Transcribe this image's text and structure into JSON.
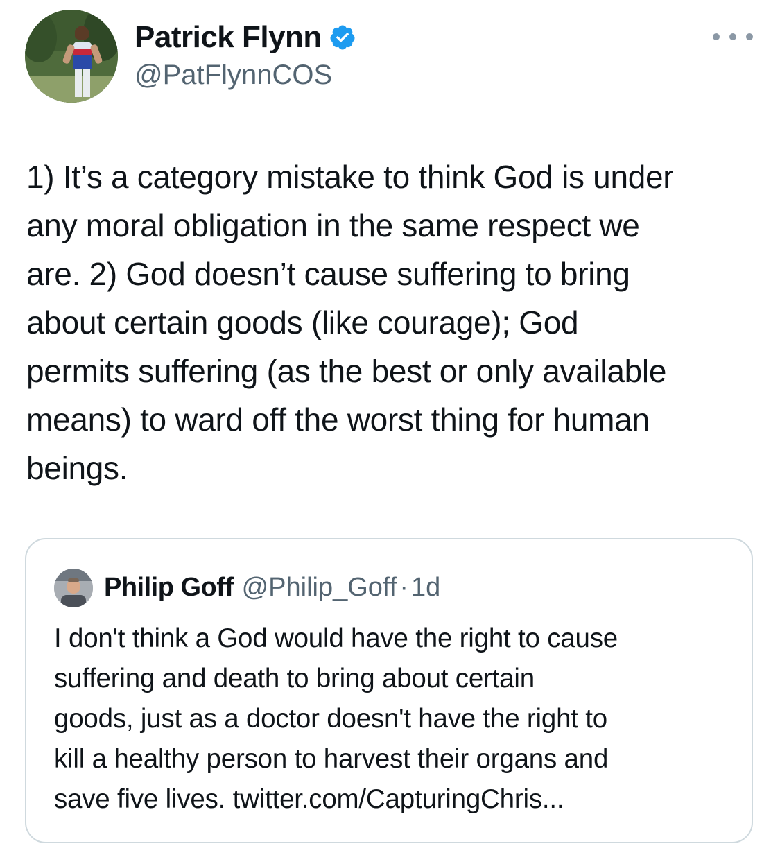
{
  "author": {
    "name": "Patrick Flynn",
    "handle": "@PatFlynnCOS",
    "verified_color": "#1d9bf0",
    "avatar_icon": "profile-photo-icon"
  },
  "tweet": {
    "text": "1) It’s a category mistake to think God is under\nany moral obligation in the same respect we\nare. 2) God doesn’t cause suffering to bring\nabout certain goods (like courage); God\npermits suffering (as the best or only available\nmeans) to ward off the worst thing for human\nbeings."
  },
  "quoted": {
    "name": "Philip Goff",
    "handle": "@Philip_Goff",
    "separator": "·",
    "time": "1d",
    "text": "I don't think a God would have the right to cause\nsuffering and death to bring about certain\ngoods, just as a doctor doesn't have the right to\nkill a healthy person to harvest their organs and\nsave five lives. twitter.com/CapturingChris..."
  },
  "colors": {
    "text_primary": "#0f1419",
    "text_secondary": "#536471",
    "border": "#cfd9de"
  }
}
